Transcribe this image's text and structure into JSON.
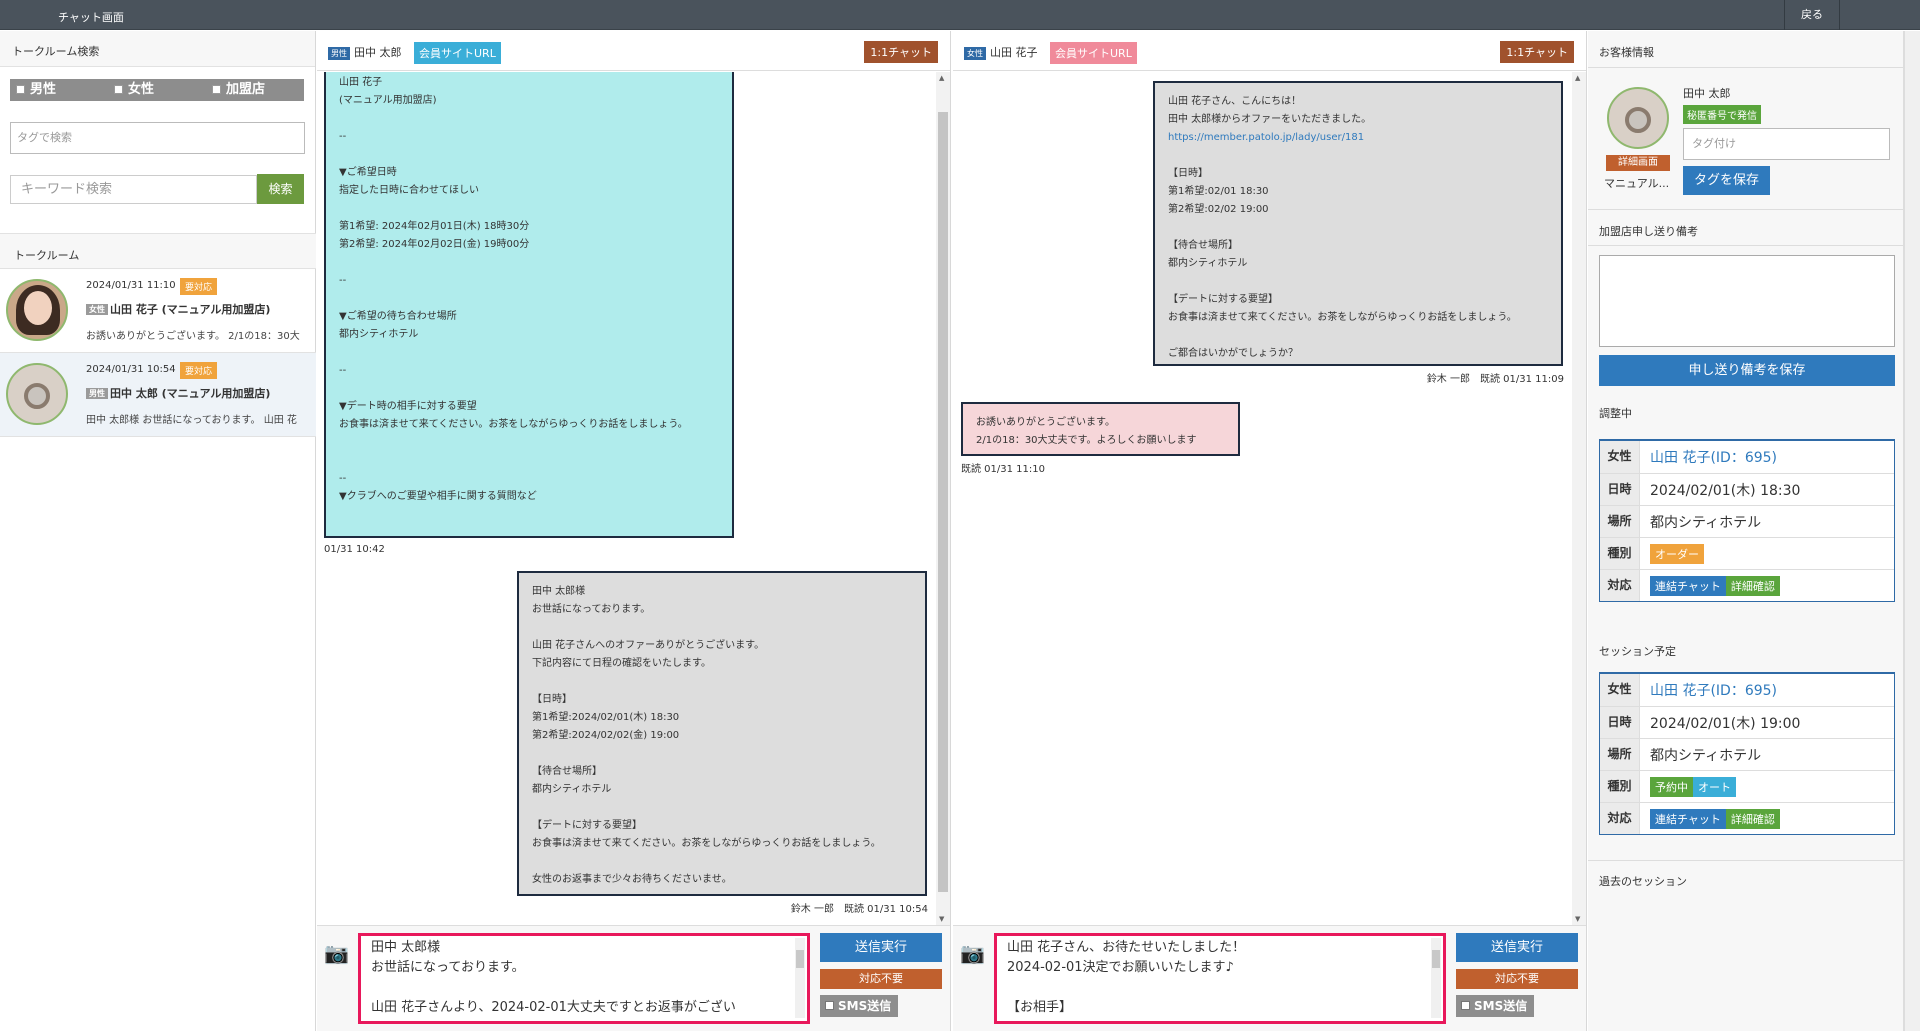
{
  "topbar": {
    "title": "チャット画面",
    "back": "戻る"
  },
  "left": {
    "search_header": "トークルーム検索",
    "gender_filters": [
      "男性",
      "女性",
      "加盟店"
    ],
    "tag_search_placeholder": "タグで検索",
    "keyword_placeholder": "キーワード検索",
    "search_button": "検索",
    "rooms_header": "トークルーム",
    "rooms": [
      {
        "datetime": "2024/01/31 11:10",
        "badge": "要対応",
        "gender": "女性",
        "name": "山田 花子 (マニュアル用加盟店)",
        "preview": "お誘いありがとうございます。 2/1の18：30大"
      },
      {
        "datetime": "2024/01/31 10:54",
        "badge": "要対応",
        "gender": "男性",
        "name": "田中 太郎 (マニュアル用加盟店)",
        "preview": "田中 太郎様 お世話になっております。 山田 花"
      }
    ]
  },
  "chat_left": {
    "gender_tag": "男性",
    "name": "田中 太郎",
    "url_button": "会員サイトURL",
    "url_color": "#3aaed8",
    "one_on_one": "1:1チャット",
    "bubble1": "山田 花子\n(マニュアル用加盟店)\n\n--\n\n▼ご希望日時\n指定した日時に合わせてほしい\n\n第1希望: 2024年02月01日(木) 18時30分\n第2希望: 2024年02月02日(金) 19時00分\n\n--\n\n▼ご希望の待ち合わせ場所\n都内シティホテル\n\n--\n\n▼デート時の相手に対する要望\nお食事は済ませて来てください。お茶をしながらゆっくりお話をしましょう。\n\n\n--\n▼クラブへのご要望や相手に関する質問など",
    "bubble1_time": "01/31 10:42",
    "bubble2": "田中 太郎様\nお世話になっております。\n\n山田 花子さんへのオファーありがとうございます。\n下記内容にて日程の確認をいたします。\n\n【日時】\n第1希望:2024/02/01(木) 18:30\n第2希望:2024/02/02(金) 19:00\n\n【待合せ場所】\n都内シティホテル\n\n【デートに対する要望】\nお食事は済ませて来てください。お茶をしながらゆっくりお話をしましょう。\n\n女性のお返事まで少々お待ちくださいませ。",
    "bubble2_meta": "鈴木 一郎　既読 01/31 10:54",
    "compose_text": "田中 太郎様\nお世話になっております。\n\n山田 花子さんより、2024-02-01大丈夫ですとお返事がござい",
    "send": "送信実行",
    "no_response": "対応不要",
    "sms": "SMS送信"
  },
  "chat_right": {
    "gender_tag": "女性",
    "name": "山田 花子",
    "url_button": "会員サイトURL",
    "url_color": "#f08a9a",
    "one_on_one": "1:1チャット",
    "bubble1_pre": "山田 花子さん、こんにちは！\n田中 太郎様からオファーをいただきました。",
    "bubble1_link": "https://member.patolo.jp/lady/user/181",
    "bubble1_post": "【日時】\n第1希望:02/01 18:30\n第2希望:02/02 19:00\n\n【待合せ場所】\n都内シティホテル\n\n【デートに対する要望】\nお食事は済ませて来てください。お茶をしながらゆっくりお話をしましょう。\n\nご都合はいかがでしょうか？",
    "bubble1_meta": "鈴木 一郎　既読 01/31 11:09",
    "bubble2": "お誘いありがとうございます。\n2/1の18：30大丈夫です。よろしくお願いします",
    "bubble2_meta": "既読 01/31 11:10",
    "compose_text": "山田 花子さん、お待たせいたしました！\n2024-02-01決定でお願いいたします♪\n\n【お相手】",
    "send": "送信実行",
    "no_response": "対応不要",
    "sms": "SMS送信"
  },
  "right": {
    "customer_header": "お客様情報",
    "customer_name": "田中 太郎",
    "secret_badge": "秘匿番号で発信",
    "detail_button": "詳細画面",
    "manual_label": "マニュアル...",
    "tag_placeholder": "タグ付け",
    "tag_save": "タグを保存",
    "notes_header": "加盟店申し送り備考",
    "notes_save": "申し送り備考を保存",
    "adjusting_header": "調整中",
    "adjusting": {
      "labels": [
        "女性",
        "日時",
        "場所",
        "種別",
        "対応"
      ],
      "woman": "山田 花子(ID：695)",
      "datetime": "2024/02/01(木) 18:30",
      "place": "都内シティホテル",
      "type_chips": [
        "オーダー"
      ],
      "actions": [
        "連結チャット",
        "詳細確認"
      ]
    },
    "session_header": "セッション予定",
    "session": {
      "labels": [
        "女性",
        "日時",
        "場所",
        "種別",
        "対応"
      ],
      "woman": "山田 花子(ID：695)",
      "datetime": "2024/02/01(木) 19:00",
      "place": "都内シティホテル",
      "type_chips": [
        "予約中",
        "オート"
      ],
      "actions": [
        "連結チャット",
        "詳細確認"
      ]
    },
    "past_header": "過去のセッション"
  }
}
